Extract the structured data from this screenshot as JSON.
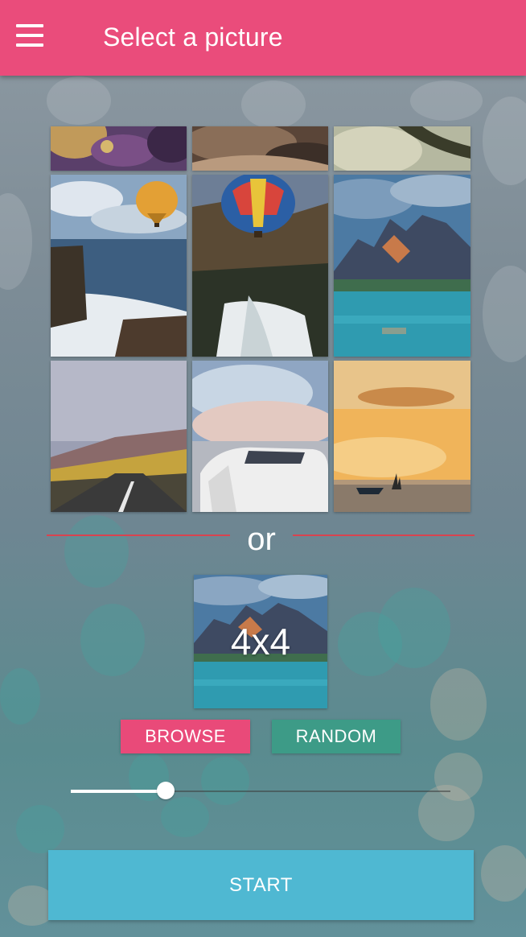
{
  "app_bar": {
    "title": "Select a picture",
    "menu_icon": "hamburger-menu-icon",
    "background_color": "#ea4c7b"
  },
  "gallery": {
    "rows": [
      [
        "flowers-partial",
        "animal-fur-partial",
        "branch-partial"
      ],
      [
        "hot-air-balloon-coast",
        "hot-air-balloon-waterfall",
        "mountain-lake"
      ],
      [
        "mountain-road",
        "white-car-sunset",
        "sunset-sea-boats"
      ]
    ]
  },
  "divider": {
    "text": "or",
    "line_color": "#d9434f"
  },
  "preview": {
    "grid_label": "4x4"
  },
  "buttons": {
    "browse": {
      "label": "BROWSE",
      "color": "#e94a79"
    },
    "random": {
      "label": "RANDOM",
      "color": "#3d9b87"
    },
    "start": {
      "label": "START",
      "color": "#4fb8d2"
    }
  },
  "difficulty_slider": {
    "value_fraction": 0.25
  }
}
